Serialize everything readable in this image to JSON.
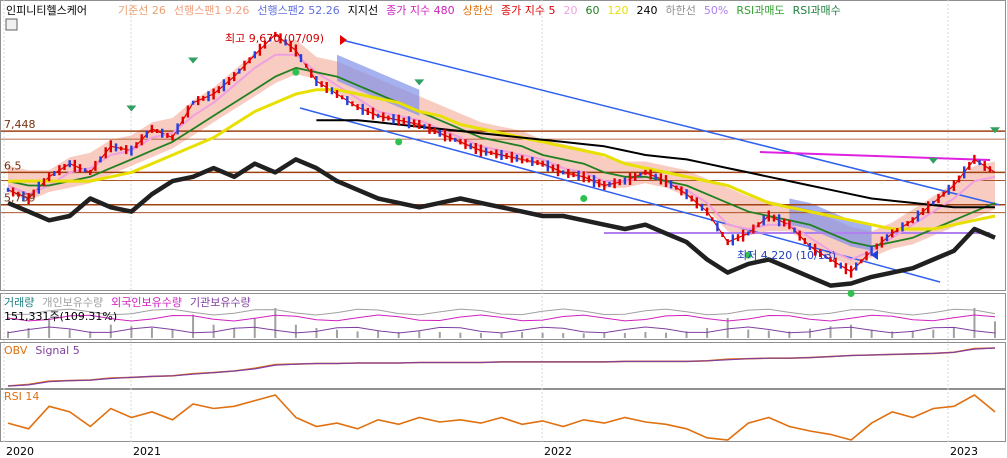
{
  "stock_name": "인피니티헬스케어",
  "main_legend": [
    {
      "label": "기준선 26",
      "color": "#e8a070"
    },
    {
      "label": "선행스팬1 9.26",
      "color": "#f0a080"
    },
    {
      "label": "선행스팬2 52.26",
      "color": "#6070e0"
    },
    {
      "label": "지지선",
      "color": "#000000"
    },
    {
      "label": "종가 지수 480",
      "color": "#d020c0"
    },
    {
      "label": "상한선",
      "color": "#e07010"
    },
    {
      "label": "종가 지수 5",
      "color": "#e00000"
    },
    {
      "label": "20",
      "color": "#f0a0e0"
    },
    {
      "label": "60",
      "color": "#208020"
    },
    {
      "label": "120",
      "color": "#e8e000"
    },
    {
      "label": "240",
      "color": "#000000"
    },
    {
      "label": "하한선",
      "color": "#909090"
    },
    {
      "label": "50%",
      "color": "#b080f0"
    },
    {
      "label": "RSI과매도",
      "color": "#30a030"
    },
    {
      "label": "RSI과매수",
      "color": "#208040"
    }
  ],
  "annotations": {
    "high": "최고 9,670 (07/09)",
    "low": "최저 4,220 (10/13)"
  },
  "price_levels": [
    "7,448",
    "6,5",
    "5,759"
  ],
  "volume_legend": [
    {
      "label": "거래량",
      "color": "#208080"
    },
    {
      "label": "개인보유수량",
      "color": "#a0a0a0"
    },
    {
      "label": "외국인보유수량",
      "color": "#d020c0"
    },
    {
      "label": "기관보유수량",
      "color": "#8040a0"
    }
  ],
  "volume_readout": "151,331주(109.31%)",
  "obv_legend": [
    {
      "label": "OBV",
      "color": "#e07010"
    },
    {
      "label": "Signal 5",
      "color": "#8040a0"
    }
  ],
  "rsi_legend": [
    {
      "label": "RSI 14",
      "color": "#e07010"
    }
  ],
  "colors": {
    "candle_up": "#e00000",
    "candle_down": "#2040e0",
    "channel": "#3060f0",
    "level_line": "#a04010",
    "ichimoku_cloud": "#f4b0a0",
    "cloud_blue": "#8090e8",
    "support": "#202020"
  },
  "chart_data": {
    "type": "line",
    "x_ticks": [
      "2020",
      "2021",
      "2022",
      "2023"
    ],
    "panels": [
      {
        "name": "price",
        "ylim": [
          3800,
          10000
        ],
        "level_lines": [
          7448,
          6500,
          5759
        ],
        "series": [
          {
            "name": "종가 지수 5",
            "values": [
              6100,
              5900,
              6400,
              6700,
              6500,
              7100,
              7000,
              7500,
              7300,
              8100,
              8300,
              8700,
              9200,
              9670,
              9300,
              8600,
              8300,
              8000,
              7800,
              7700,
              7600,
              7400,
              7200,
              7000,
              6900,
              6800,
              6700,
              6500,
              6400,
              6200,
              6300,
              6500,
              6300,
              6000,
              5600,
              4900,
              5100,
              5500,
              5300,
              4800,
              4500,
              4220,
              4700,
              5100,
              5400,
              5800,
              6200,
              6800,
              6500
            ]
          },
          {
            "name": "20",
            "values": [
              6200,
              6000,
              6200,
              6500,
              6600,
              6900,
              7000,
              7300,
              7400,
              7800,
              8100,
              8500,
              8900,
              9200,
              9200,
              8800,
              8500,
              8200,
              7900,
              7800,
              7700,
              7500,
              7300,
              7100,
              7000,
              6900,
              6800,
              6600,
              6500,
              6300,
              6300,
              6400,
              6300,
              6100,
              5800,
              5300,
              5200,
              5300,
              5300,
              5000,
              4700,
              4500,
              4700,
              5000,
              5300,
              5600,
              5900,
              6300,
              6400
            ]
          },
          {
            "name": "60",
            "values": [
              6300,
              6200,
              6200,
              6300,
              6400,
              6600,
              6800,
              7000,
              7200,
              7500,
              7800,
              8100,
              8400,
              8700,
              8900,
              8800,
              8700,
              8500,
              8300,
              8100,
              7900,
              7700,
              7500,
              7300,
              7200,
              7100,
              6900,
              6800,
              6700,
              6500,
              6400,
              6400,
              6300,
              6200,
              6000,
              5800,
              5600,
              5500,
              5400,
              5300,
              5100,
              4900,
              4800,
              4900,
              5000,
              5200,
              5400,
              5600,
              5800
            ]
          },
          {
            "name": "120",
            "values": [
              6300,
              6300,
              6300,
              6300,
              6300,
              6400,
              6500,
              6700,
              6900,
              7100,
              7300,
              7600,
              7900,
              8100,
              8300,
              8400,
              8400,
              8300,
              8200,
              8100,
              7900,
              7800,
              7600,
              7500,
              7400,
              7300,
              7200,
              7100,
              7000,
              6900,
              6700,
              6600,
              6500,
              6400,
              6300,
              6200,
              6000,
              5800,
              5700,
              5600,
              5500,
              5400,
              5300,
              5200,
              5200,
              5200,
              5300,
              5400,
              5500
            ]
          },
          {
            "name": "240",
            "values": [
              null,
              null,
              null,
              null,
              null,
              null,
              null,
              null,
              null,
              null,
              null,
              null,
              null,
              null,
              null,
              7700,
              7700,
              7700,
              7650,
              7600,
              7550,
              7500,
              7450,
              7400,
              7350,
              7300,
              7250,
              7200,
              7150,
              7100,
              7000,
              6900,
              6850,
              6800,
              6700,
              6600,
              6500,
              6400,
              6300,
              6200,
              6100,
              6000,
              5900,
              5850,
              5800,
              5750,
              5700,
              5700,
              5700
            ]
          },
          {
            "name": "지지선",
            "values": [
              5800,
              5600,
              5400,
              5500,
              5900,
              5700,
              5600,
              6000,
              6300,
              6400,
              6600,
              6400,
              6700,
              6500,
              6800,
              6600,
              6300,
              6100,
              5900,
              5800,
              5700,
              5800,
              5900,
              5800,
              5700,
              5600,
              5500,
              5500,
              5400,
              5300,
              5200,
              5300,
              5100,
              4900,
              4500,
              4200,
              4400,
              4500,
              4300,
              4100,
              3900,
              3950,
              4100,
              4200,
              4300,
              4500,
              4700,
              5200,
              5000
            ]
          }
        ]
      },
      {
        "name": "volume",
        "series": [
          {
            "name": "거래량",
            "values": [
              20,
              30,
              60,
              25,
              20,
              40,
              35,
              30,
              25,
              70,
              40,
              30,
              60,
              90,
              40,
              30,
              25,
              20,
              22,
              18,
              20,
              18,
              16,
              15,
              14,
              18,
              16,
              15,
              14,
              16,
              15,
              18,
              16,
              20,
              30,
              60,
              25,
              22,
              20,
              28,
              35,
              40,
              25,
              20,
              22,
              25,
              30,
              90,
              50
            ]
          }
        ]
      },
      {
        "name": "obv",
        "series": [
          {
            "name": "OBV",
            "values": [
              5,
              8,
              14,
              15,
              16,
              20,
              21,
              23,
              24,
              28,
              30,
              33,
              38,
              45,
              46,
              47,
              47,
              48,
              48,
              48,
              49,
              49,
              49,
              49,
              50,
              50,
              50,
              50,
              50,
              50,
              51,
              51,
              51,
              51,
              52,
              55,
              56,
              57,
              57,
              58,
              60,
              62,
              63,
              64,
              65,
              66,
              68,
              75,
              76
            ]
          },
          {
            "name": "Signal 5",
            "values": [
              5,
              7,
              13,
              15,
              16,
              19,
              21,
              23,
              24,
              27,
              30,
              33,
              37,
              44,
              46,
              47,
              47,
              48,
              48,
              48,
              49,
              49,
              49,
              49,
              50,
              50,
              50,
              50,
              50,
              50,
              51,
              51,
              51,
              51,
              52,
              54,
              56,
              57,
              57,
              58,
              60,
              62,
              63,
              64,
              65,
              66,
              68,
              74,
              76
            ]
          }
        ]
      },
      {
        "name": "rsi",
        "series": [
          {
            "name": "RSI 14",
            "values": [
              45,
              40,
              60,
              55,
              42,
              58,
              50,
              55,
              48,
              62,
              58,
              60,
              65,
              70,
              50,
              42,
              45,
              40,
              48,
              44,
              50,
              46,
              48,
              45,
              50,
              44,
              47,
              42,
              48,
              45,
              50,
              46,
              44,
              40,
              32,
              30,
              45,
              50,
              42,
              38,
              35,
              30,
              45,
              55,
              50,
              58,
              60,
              70,
              55
            ]
          }
        ]
      }
    ]
  }
}
